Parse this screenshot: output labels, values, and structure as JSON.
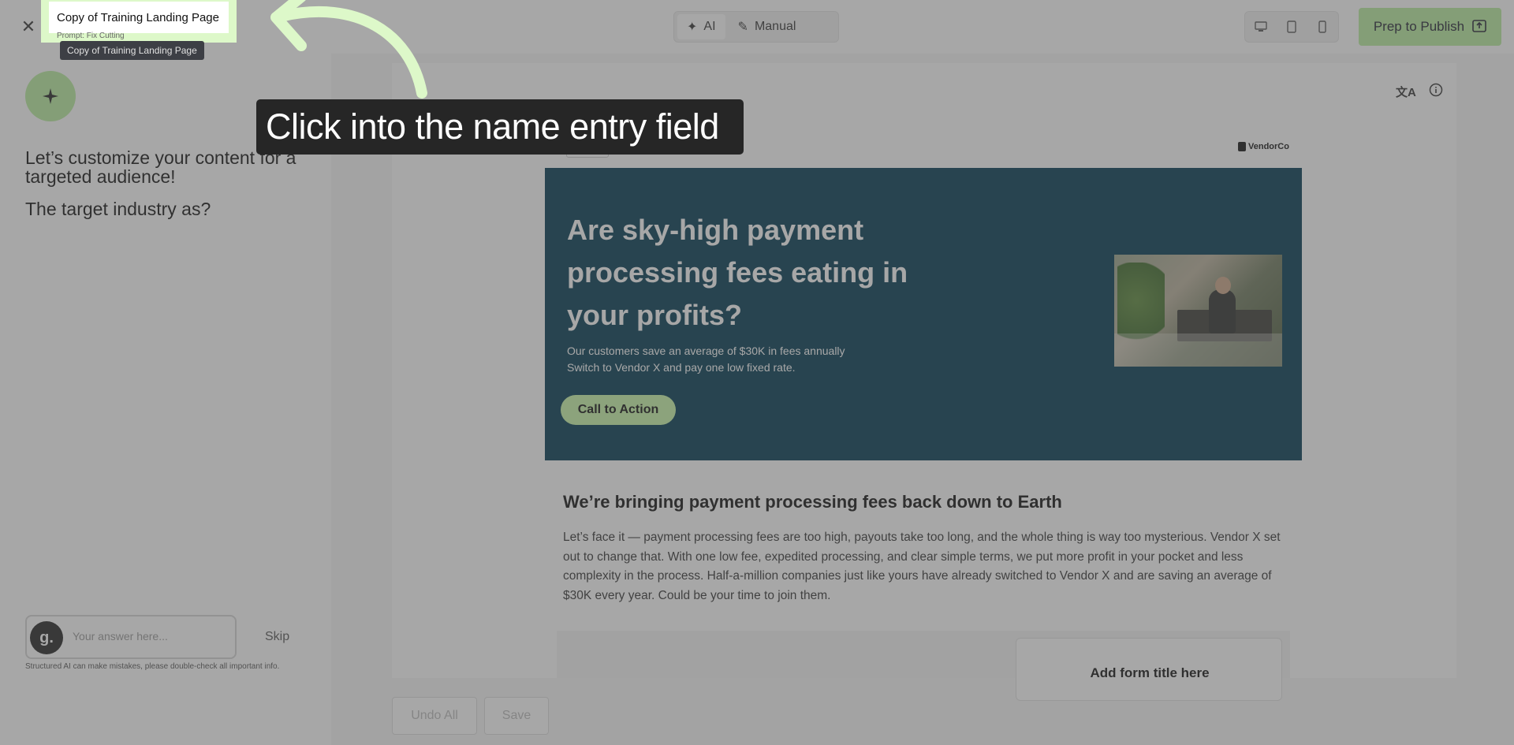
{
  "header": {
    "name_field_value": "Copy of Training Landing Page",
    "name_field_ghost": "Prompt: Fix Cutting",
    "tooltip": "Copy of Training Landing Page",
    "close_icon": "close-icon",
    "modes": [
      {
        "label": "AI",
        "icon": "sparkle-icon"
      },
      {
        "label": "Manual",
        "icon": "pencil-icon"
      }
    ],
    "devices": [
      "desktop-icon",
      "tablet-icon",
      "mobile-icon"
    ],
    "publish_label": "Prep to Publish",
    "accent_color": "#b9ec9e"
  },
  "walkthrough": {
    "callout_text": "Click into the name entry field"
  },
  "assistant": {
    "prompt_1": "Let’s customize your content for a targeted audience!",
    "prompt_2": "The target industry as?",
    "answer_placeholder": "Your answer here...",
    "skip_label": "Skip",
    "disclaimer": "Structured AI can make mistakes, please double-check all important info."
  },
  "editor": {
    "undo_label": "Undo All",
    "save_label": "Save",
    "corner_tools": [
      "translate-icon",
      "info-icon"
    ]
  },
  "page": {
    "vendor_logo": "VendorCo",
    "hero": {
      "title": "Are sky-high payment processing fees eating in your profits?",
      "subtitle_line_1": "Our customers save an average of $30K in fees annually",
      "subtitle_line_2": "Switch to Vendor X and pay one low fixed rate.",
      "cta_label": "Call to Action",
      "bg_color": "#013950",
      "cta_color": "#c9f7a9"
    },
    "section_title": "We’re bringing payment processing fees back down to Earth",
    "section_body": "Let’s face it — payment processing fees are too high, payouts take too long, and the whole thing is way too mysterious. Vendor X set out to change that. With one low fee, expedited processing, and clear simple terms, we put more profit in your pocket and less complexity in the process. Half-a-million companies just like yours have already switched to Vendor X and are saving an average of $30K every year. Could be your time to join them.",
    "form_title": "Add form title here"
  }
}
